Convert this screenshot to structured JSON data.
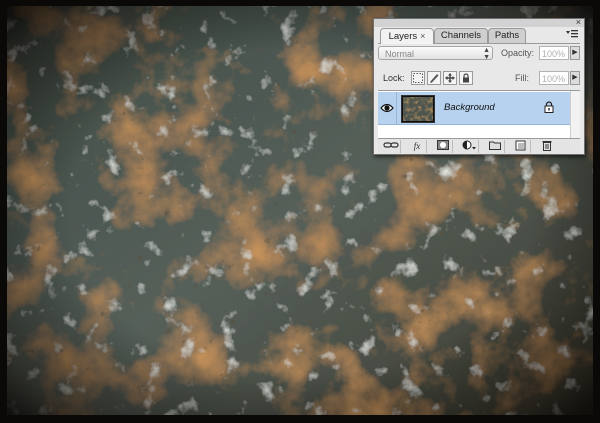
{
  "panel": {
    "tabs": [
      {
        "label": "Layers",
        "active": true
      },
      {
        "label": "Channels",
        "active": false
      },
      {
        "label": "Paths",
        "active": false
      }
    ],
    "close_glyph": "×",
    "blend_mode": "Normal",
    "opacity_label": "Opacity:",
    "opacity_value": "100%",
    "lock_label": "Lock:",
    "fill_label": "Fill:",
    "fill_value": "100%",
    "layer": {
      "name": "Background",
      "visible": true,
      "locked": true
    }
  },
  "icons": {
    "lock_buttons": [
      "lock-transparent-pixels-icon",
      "lock-image-pixels-icon",
      "lock-position-icon",
      "lock-all-icon"
    ],
    "bottom_bar": [
      "link-layers-icon",
      "add-layer-style-icon",
      "add-layer-mask-icon",
      "new-adjustment-layer-icon",
      "new-group-icon",
      "new-layer-icon",
      "delete-layer-icon"
    ]
  },
  "colors": {
    "selected_layer": "#b7d2ef",
    "panel_bg": "#e8e8e8"
  }
}
